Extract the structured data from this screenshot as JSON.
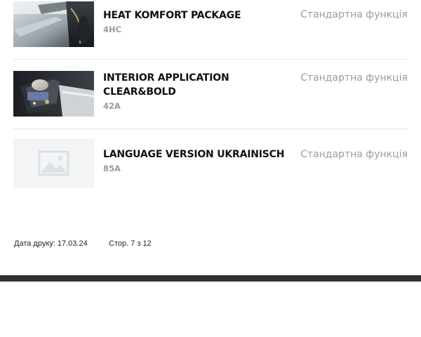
{
  "items": [
    {
      "title": "HEAT KOMFORT PACKAGE",
      "code": "4HC",
      "status": "Стандартна функція",
      "thumbnail": "car-interior-door-photo"
    },
    {
      "title": "INTERIOR APPLICATION CLEAR&BOLD",
      "code": "42A",
      "status": "Стандартна функція",
      "thumbnail": "car-console-photo"
    },
    {
      "title": "LANGUAGE VERSION UKRAINISCH",
      "code": "85A",
      "status": "Стандартна функція",
      "thumbnail": "image-placeholder-icon"
    }
  ],
  "footer": {
    "print_date": "Дата друку: 17.03.24",
    "page": "Стор. 7 з 12"
  },
  "colors": {
    "title": "#111111",
    "code": "#9a9a9a",
    "status": "#9c9c9c",
    "divider": "#e6e6e6",
    "bottom_bar": "#2f3133",
    "placeholder_bg": "#f2f4f5"
  }
}
